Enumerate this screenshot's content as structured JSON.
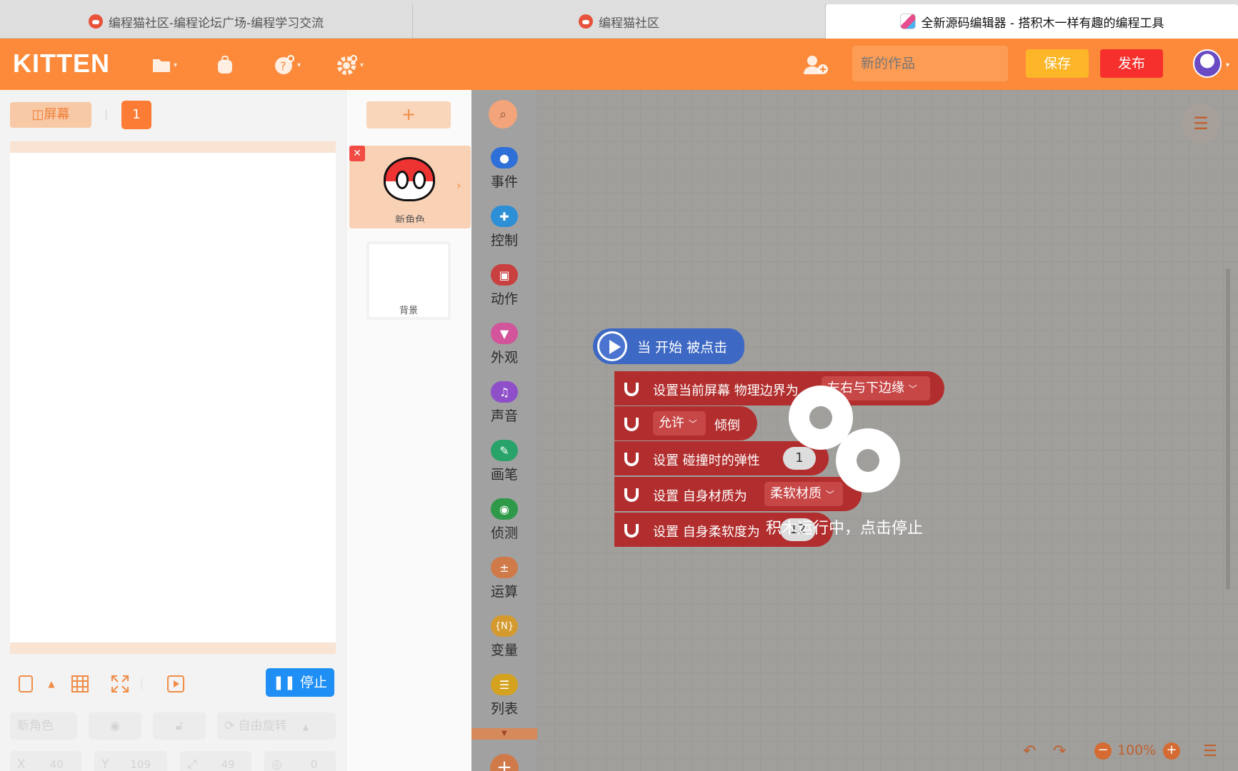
{
  "browser_tabs": [
    {
      "title": "编程猫社区-编程论坛广场-编程学习交流",
      "active": false
    },
    {
      "title": "编程猫社区",
      "active": false
    },
    {
      "title": "全新源码编辑器 - 搭积木一样有趣的编程工具",
      "active": true
    }
  ],
  "header": {
    "logo": "KITTEN",
    "icons": [
      "folder-icon",
      "backpack-icon",
      "help-icon",
      "settings-icon",
      "add-collaborator-icon"
    ],
    "project_name_placeholder": "新的作品",
    "save_label": "保存",
    "publish_label": "发布"
  },
  "stage": {
    "screen_label": "屏幕",
    "page_number": "1",
    "stop_label": "停止",
    "props": {
      "name_placeholder": "新角色",
      "rotation_mode": "自由旋转",
      "x_label": "X",
      "x_value": "40",
      "y_label": "Y",
      "y_value": "109",
      "size_value": "49",
      "direction_value": "0"
    }
  },
  "sprites": {
    "add_label": "+",
    "items": [
      {
        "name": "新角色",
        "selected": true
      }
    ],
    "background_label": "背景"
  },
  "categories": [
    {
      "label": "事件",
      "color": "#2f6fd8",
      "icon": "event-icon"
    },
    {
      "label": "控制",
      "color": "#2d8fd6",
      "icon": "control-icon"
    },
    {
      "label": "动作",
      "color": "#c94040",
      "icon": "motion-icon"
    },
    {
      "label": "外观",
      "color": "#d2549a",
      "icon": "looks-icon"
    },
    {
      "label": "声音",
      "color": "#8e4fc9",
      "icon": "sound-icon"
    },
    {
      "label": "画笔",
      "color": "#2aa36a",
      "icon": "pen-icon"
    },
    {
      "label": "侦测",
      "color": "#2e9a49",
      "icon": "sensing-icon"
    },
    {
      "label": "运算",
      "color": "#d07a4a",
      "icon": "operator-icon"
    },
    {
      "label": "变量",
      "color": "#d49a2e",
      "icon": "variable-icon"
    },
    {
      "label": "列表",
      "color": "#d4a21e",
      "icon": "list-icon"
    }
  ],
  "script": {
    "hat_label": "当 开始 被点击",
    "blocks": [
      {
        "parts": [
          "设置当前屏幕 物理边界为"
        ],
        "dropdown": "左右与下边缘"
      },
      {
        "dropdown": "允许",
        "suffix": "倾倒"
      },
      {
        "parts": [
          "设置 碰撞时的弹性"
        ],
        "value": "1"
      },
      {
        "parts": [
          "设置 自身材质为"
        ],
        "dropdown": "柔软材质"
      },
      {
        "parts": [
          "设置 自身柔软度为"
        ],
        "value": "12"
      }
    ],
    "running_message": "积木运行中，点击停止"
  },
  "workspace": {
    "zoom": "100%"
  }
}
